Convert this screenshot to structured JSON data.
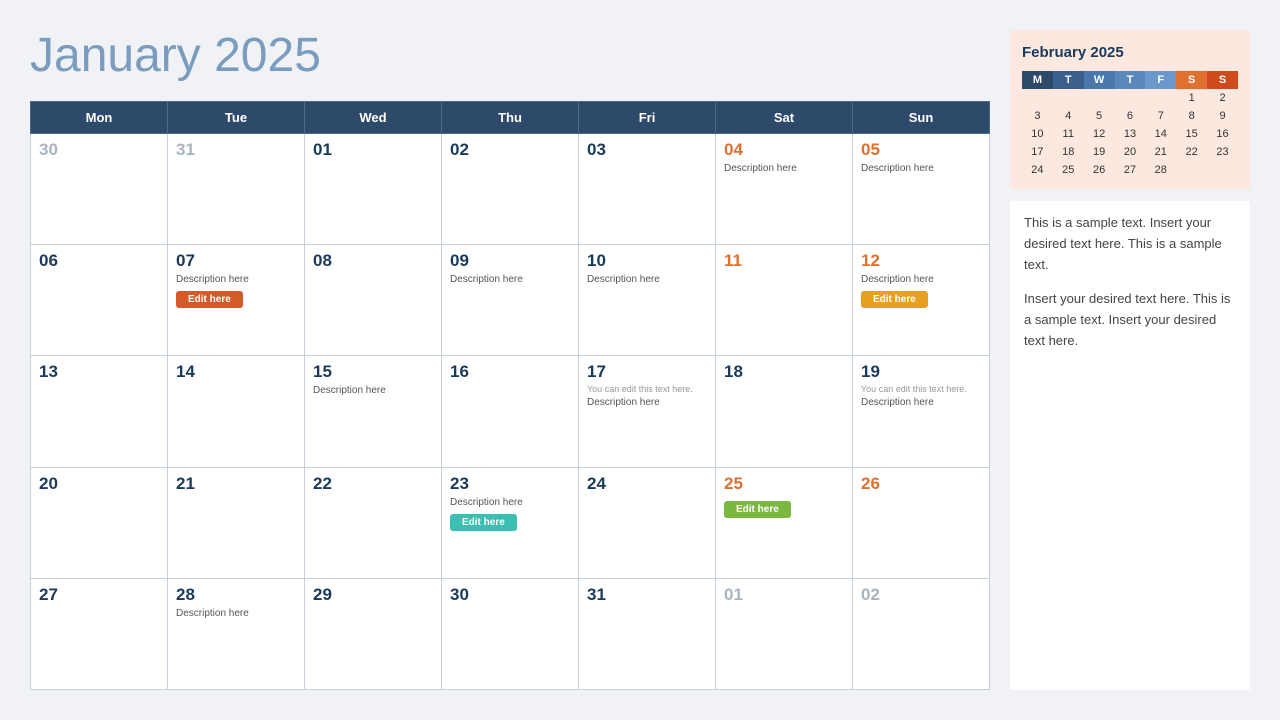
{
  "header": {
    "title_bold": "January",
    "title_year": "2025"
  },
  "calendar": {
    "weekdays": [
      "Mon",
      "Tue",
      "Wed",
      "Thu",
      "Fri",
      "Sat",
      "Sun"
    ],
    "weeks": [
      [
        {
          "num": "30",
          "style": "muted",
          "desc": "",
          "btn": null,
          "note": null
        },
        {
          "num": "31",
          "style": "muted",
          "desc": "",
          "btn": null,
          "note": null
        },
        {
          "num": "01",
          "style": "normal",
          "desc": "",
          "btn": null,
          "note": null
        },
        {
          "num": "02",
          "style": "normal",
          "desc": "",
          "btn": null,
          "note": null
        },
        {
          "num": "03",
          "style": "normal",
          "desc": "",
          "btn": null,
          "note": null
        },
        {
          "num": "04",
          "style": "orange",
          "desc": "Description here",
          "btn": null,
          "note": null
        },
        {
          "num": "05",
          "style": "orange",
          "desc": "Description here",
          "btn": null,
          "note": null
        }
      ],
      [
        {
          "num": "06",
          "style": "normal",
          "desc": "",
          "btn": null,
          "note": null
        },
        {
          "num": "07",
          "style": "normal",
          "desc": "Description here",
          "btn": {
            "label": "Edit here",
            "color": "red"
          },
          "note": null
        },
        {
          "num": "08",
          "style": "normal",
          "desc": "",
          "btn": null,
          "note": null
        },
        {
          "num": "09",
          "style": "normal",
          "desc": "Description here",
          "btn": null,
          "note": null
        },
        {
          "num": "10",
          "style": "normal",
          "desc": "Description here",
          "btn": null,
          "note": null
        },
        {
          "num": "11",
          "style": "orange",
          "desc": "",
          "btn": null,
          "note": null
        },
        {
          "num": "12",
          "style": "orange",
          "desc": "Description here",
          "btn": {
            "label": "Edit here",
            "color": "orange"
          },
          "note": null
        }
      ],
      [
        {
          "num": "13",
          "style": "normal",
          "desc": "",
          "btn": null,
          "note": null
        },
        {
          "num": "14",
          "style": "normal",
          "desc": "",
          "btn": null,
          "note": null
        },
        {
          "num": "15",
          "style": "normal",
          "desc": "Description here",
          "btn": null,
          "note": null
        },
        {
          "num": "16",
          "style": "normal",
          "desc": "",
          "btn": null,
          "note": null
        },
        {
          "num": "17",
          "style": "normal",
          "desc": "Description here",
          "btn": null,
          "note": "You can edit this text here."
        },
        {
          "num": "18",
          "style": "normal",
          "desc": "",
          "btn": null,
          "note": null
        },
        {
          "num": "19",
          "style": "normal",
          "desc": "Description here",
          "btn": null,
          "note": "You can edit this text here."
        }
      ],
      [
        {
          "num": "20",
          "style": "normal",
          "desc": "",
          "btn": null,
          "note": null
        },
        {
          "num": "21",
          "style": "normal",
          "desc": "",
          "btn": null,
          "note": null
        },
        {
          "num": "22",
          "style": "normal",
          "desc": "",
          "btn": null,
          "note": null
        },
        {
          "num": "23",
          "style": "normal",
          "desc": "Description here",
          "btn": {
            "label": "Edit here",
            "color": "teal"
          },
          "note": null
        },
        {
          "num": "24",
          "style": "normal",
          "desc": "",
          "btn": null,
          "note": null
        },
        {
          "num": "25",
          "style": "orange",
          "desc": "",
          "btn": {
            "label": "Edit here",
            "color": "green"
          },
          "note": null
        },
        {
          "num": "26",
          "style": "orange",
          "desc": "",
          "btn": null,
          "note": null
        }
      ],
      [
        {
          "num": "27",
          "style": "normal",
          "desc": "",
          "btn": null,
          "note": null
        },
        {
          "num": "28",
          "style": "normal",
          "desc": "Description here",
          "btn": null,
          "note": null
        },
        {
          "num": "29",
          "style": "normal",
          "desc": "",
          "btn": null,
          "note": null
        },
        {
          "num": "30",
          "style": "normal",
          "desc": "",
          "btn": null,
          "note": null
        },
        {
          "num": "31",
          "style": "normal",
          "desc": "",
          "btn": null,
          "note": null
        },
        {
          "num": "01",
          "style": "muted",
          "desc": "",
          "btn": null,
          "note": null
        },
        {
          "num": "02",
          "style": "muted",
          "desc": "",
          "btn": null,
          "note": null
        }
      ]
    ]
  },
  "mini_cal": {
    "title": "February 2025",
    "headers": [
      "M",
      "T",
      "W",
      "T",
      "F",
      "S",
      "S"
    ],
    "weeks": [
      [
        null,
        null,
        null,
        null,
        null,
        "1",
        "2"
      ],
      [
        "3",
        "4",
        "5",
        "6",
        "7",
        "8",
        "9"
      ],
      [
        "10",
        "11",
        "12",
        "13",
        "14",
        "15",
        "16"
      ],
      [
        "17",
        "18",
        "19",
        "20",
        "21",
        "22",
        "23"
      ],
      [
        "24",
        "25",
        "26",
        "27",
        "28",
        null,
        null
      ]
    ]
  },
  "sidebar_text": {
    "para1": "This is a sample text. Insert your desired text here. This is a sample text.",
    "para2": "Insert your desired text here. This is a sample text. Insert your desired text here."
  }
}
